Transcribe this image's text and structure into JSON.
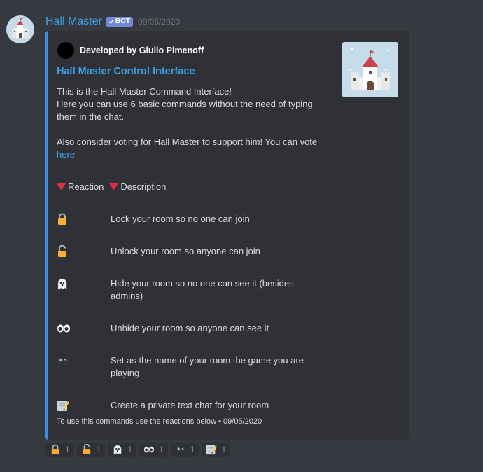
{
  "message": {
    "username": "Hall Master",
    "bot_tag": "BOT",
    "timestamp": "09/05/2020"
  },
  "embed": {
    "author": "Developed by Giulio Pimenoff",
    "title": "Hall Master Control Interface",
    "description_lines": [
      "This is the Hall Master Command Interface!",
      "Here you can use 6 basic commands without the need of typing",
      "them in the chat.",
      "Also consider voting for Hall Master to support him! You can vote"
    ],
    "vote_link": "here",
    "field_headers": [
      "Reaction",
      "Description"
    ],
    "rows": [
      {
        "icon": "lock-icon",
        "text": "Lock your room so no one can join"
      },
      {
        "icon": "unlock-icon",
        "text": "Unlock your room so anyone can join"
      },
      {
        "icon": "ghost-icon",
        "text": "Hide your room so no one can see it (besides admins)"
      },
      {
        "icon": "eyes-icon",
        "text": "Unhide your room so anyone can see it"
      },
      {
        "icon": "game-controller-icon",
        "text": "Set as the name of your room the game you are playing"
      },
      {
        "icon": "memo-icon",
        "text": "Create a private text chat for your room"
      }
    ],
    "footer": "To use this commands use the reactions below • 09/05/2020"
  },
  "reactions": [
    {
      "icon": "lock-icon",
      "count": "1"
    },
    {
      "icon": "unlock-icon",
      "count": "1"
    },
    {
      "icon": "ghost-icon",
      "count": "1"
    },
    {
      "icon": "eyes-icon",
      "count": "1"
    },
    {
      "icon": "game-controller-icon",
      "count": "1"
    },
    {
      "icon": "memo-icon",
      "count": "1"
    }
  ],
  "colors": {
    "background": "#36393f",
    "embed_bg": "#2f3136",
    "embed_border": "#3b8ee4",
    "link": "#3ba3ea",
    "bot_tag": "#7289da",
    "triangle": "#dd2e44"
  }
}
